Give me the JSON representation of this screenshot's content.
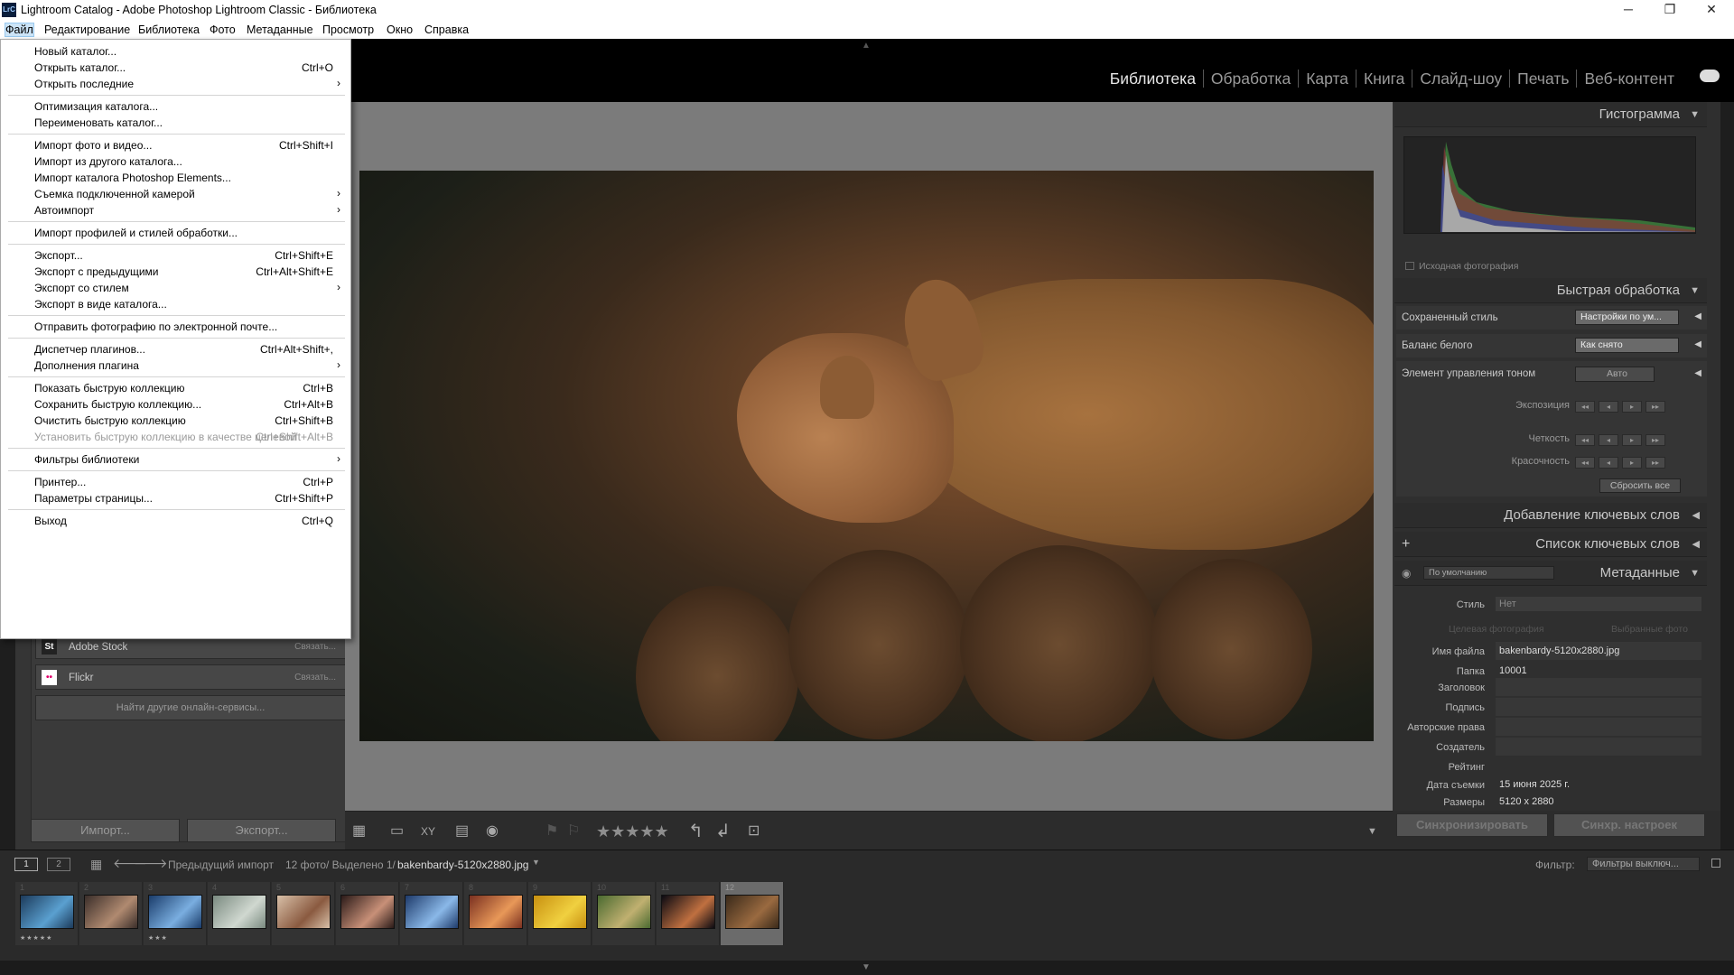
{
  "window": {
    "title": "Lightroom Catalog - Adobe Photoshop Lightroom Classic - Библиотека",
    "icon_text": "LrC"
  },
  "menubar": [
    "Файл",
    "Редактирование",
    "Библиотека",
    "Фото",
    "Метаданные",
    "Просмотр",
    "Окно",
    "Справка"
  ],
  "modules": [
    "Библиотека",
    "Обработка",
    "Карта",
    "Книга",
    "Слайд-шоу",
    "Печать",
    "Веб-контент"
  ],
  "file_menu": [
    {
      "label": "Новый каталог...",
      "shortcut": ""
    },
    {
      "label": "Открыть каталог...",
      "shortcut": "Ctrl+O"
    },
    {
      "label": "Открыть последние",
      "shortcut": "",
      "submenu": true
    },
    {
      "sep": true
    },
    {
      "label": "Оптимизация каталога...",
      "shortcut": ""
    },
    {
      "label": "Переименовать каталог...",
      "shortcut": ""
    },
    {
      "sep": true
    },
    {
      "label": "Импорт фото и видео...",
      "shortcut": "Ctrl+Shift+I"
    },
    {
      "label": "Импорт из другого каталога...",
      "shortcut": ""
    },
    {
      "label": "Импорт каталога Photoshop Elements...",
      "shortcut": ""
    },
    {
      "label": "Съемка подключенной камерой",
      "shortcut": "",
      "submenu": true
    },
    {
      "label": "Автоимпорт",
      "shortcut": "",
      "submenu": true
    },
    {
      "sep": true
    },
    {
      "label": "Импорт профилей и стилей обработки...",
      "shortcut": ""
    },
    {
      "sep": true
    },
    {
      "label": "Экспорт...",
      "shortcut": "Ctrl+Shift+E"
    },
    {
      "label": "Экспорт с предыдущими",
      "shortcut": "Ctrl+Alt+Shift+E"
    },
    {
      "label": "Экспорт со стилем",
      "shortcut": "",
      "submenu": true
    },
    {
      "label": "Экспорт в виде каталога...",
      "shortcut": ""
    },
    {
      "sep": true
    },
    {
      "label": "Отправить фотографию по электронной почте...",
      "shortcut": ""
    },
    {
      "sep": true
    },
    {
      "label": "Диспетчер плагинов...",
      "shortcut": "Ctrl+Alt+Shift+,"
    },
    {
      "label": "Дополнения плагина",
      "shortcut": "",
      "submenu": true
    },
    {
      "sep": true
    },
    {
      "label": "Показать быструю коллекцию",
      "shortcut": "Ctrl+B"
    },
    {
      "label": "Сохранить быструю коллекцию...",
      "shortcut": "Ctrl+Alt+B"
    },
    {
      "label": "Очистить быструю коллекцию",
      "shortcut": "Ctrl+Shift+B"
    },
    {
      "label": "Установить быструю коллекцию в качестве целевой",
      "shortcut": "Ctrl+Shift+Alt+B",
      "disabled": true
    },
    {
      "sep": true
    },
    {
      "label": "Фильтры библиотеки",
      "shortcut": "",
      "submenu": true
    },
    {
      "sep": true
    },
    {
      "label": "Принтер...",
      "shortcut": "Ctrl+P"
    },
    {
      "label": "Параметры страницы...",
      "shortcut": "Ctrl+Shift+P"
    },
    {
      "sep": true
    },
    {
      "label": "Выход",
      "shortcut": "Ctrl+Q"
    }
  ],
  "left_panel": {
    "services": [
      {
        "icon": "St",
        "name": "Adobe Stock",
        "action": "Связать..."
      },
      {
        "icon": "••",
        "name": "Flickr",
        "action": "Связать..."
      }
    ],
    "find_more": "Найти другие онлайн-сервисы...",
    "import_btn": "Импорт...",
    "export_btn": "Экспорт..."
  },
  "right_panel": {
    "histogram_title": "Гистограмма",
    "original_photo": "Исходная фотография",
    "quick_develop": "Быстрая обработка",
    "saved_preset_label": "Сохраненный стиль",
    "saved_preset_value": "Настройки по ум...",
    "wb_label": "Баланс белого",
    "wb_value": "Как снято",
    "tone_label": "Элемент управления тоном",
    "auto": "Авто",
    "exposure": "Экспозиция",
    "clarity": "Четкость",
    "vibrance": "Красочность",
    "reset_all": "Сбросить все",
    "keywording": "Добавление ключевых слов",
    "keyword_list": "Список ключевых слов",
    "metadata_title": "Метаданные",
    "metadata_preset": "По умолчанию",
    "style_label": "Стиль",
    "style_value": "Нет",
    "target_photo": "Целевая фотография",
    "selected_photos": "Выбранные фото",
    "fields": [
      {
        "k": "Имя файла",
        "v": "bakenbardy-5120x2880.jpg"
      },
      {
        "k": "Папка",
        "v": "10001"
      },
      {
        "k": "Заголовок",
        "v": ""
      },
      {
        "k": "Подпись",
        "v": ""
      },
      {
        "k": "Авторские права",
        "v": ""
      },
      {
        "k": "Создатель",
        "v": ""
      },
      {
        "k": "Рейтинг",
        "v": ""
      },
      {
        "k": "Дата съемки",
        "v": "15 июня 2025 г."
      },
      {
        "k": "Размеры",
        "v": "5120 x 2880"
      }
    ],
    "sync_btn": "Синхронизировать",
    "sync_settings_btn": "Синхр. настроек"
  },
  "filmstrip_bar": {
    "screen1": "1",
    "screen2": "2",
    "source": "Предыдущий импорт",
    "count": "12 фото/ Выделено 1/",
    "filename": "bakenbardy-5120x2880.jpg",
    "filter_label": "Фильтр:",
    "filter_value": "Фильтры выключ..."
  },
  "thumbnails": [
    {
      "n": "1",
      "c1": "#1c3a5a",
      "c2": "#5aa0d0",
      "stars": "★★★★★"
    },
    {
      "n": "2",
      "c1": "#3a2e2a",
      "c2": "#b08a70",
      "stars": ""
    },
    {
      "n": "3",
      "c1": "#1a3c6a",
      "c2": "#7aaee0",
      "stars": "★★★"
    },
    {
      "n": "4",
      "c1": "#7a8a80",
      "c2": "#d0d8d0",
      "stars": ""
    },
    {
      "n": "5",
      "c1": "#d8c0a8",
      "c2": "#8a5a40",
      "stars": ""
    },
    {
      "n": "6",
      "c1": "#2a1a18",
      "c2": "#c89078",
      "stars": ""
    },
    {
      "n": "7",
      "c1": "#1e3a6a",
      "c2": "#8ab8e8",
      "stars": ""
    },
    {
      "n": "8",
      "c1": "#7a3020",
      "c2": "#e89858",
      "stars": ""
    },
    {
      "n": "9",
      "c1": "#c89010",
      "c2": "#f0d040",
      "stars": ""
    },
    {
      "n": "10",
      "c1": "#4a6a30",
      "c2": "#c0b070",
      "stars": ""
    },
    {
      "n": "11",
      "c1": "#0a0a12",
      "c2": "#c07040",
      "stars": ""
    },
    {
      "n": "12",
      "c1": "#3a2a1a",
      "c2": "#9a6a40",
      "stars": ""
    }
  ],
  "colors": {
    "panel": "#353535",
    "accent_selected": "#6b6b6b",
    "menu_highlight": "#cce4f7"
  }
}
